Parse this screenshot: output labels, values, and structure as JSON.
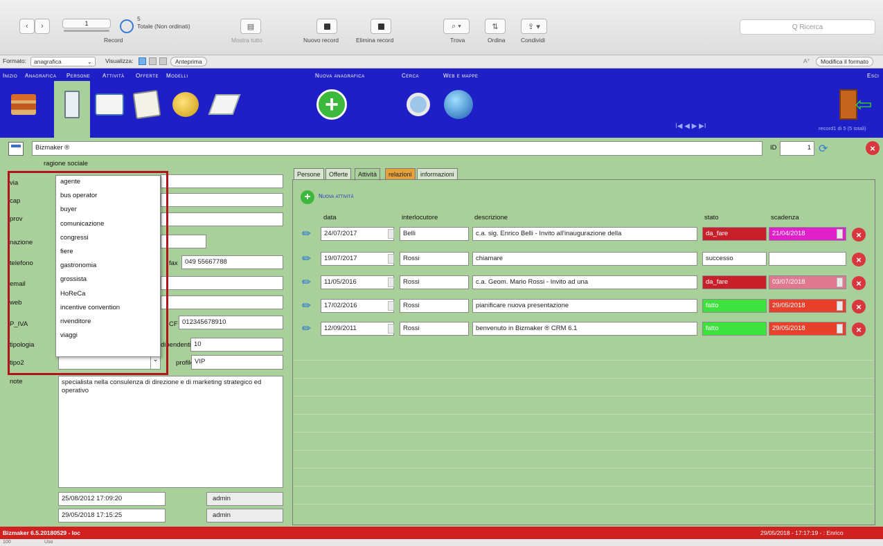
{
  "toolbar": {
    "record_value": "1",
    "record_label": "Record",
    "total_count": "5",
    "total_label": "Totale (Non ordinati)",
    "show_all_label": "Mostra tutto",
    "new_record_label": "Nuovo record",
    "delete_record_label": "Elimina record",
    "find_label": "Trova",
    "sort_label": "Ordina",
    "share_label": "Condividi",
    "search_placeholder": "Q Ricerca"
  },
  "format_row": {
    "format_label": "Formato:",
    "format_value": "anagrafica",
    "view_label": "Visualizza:",
    "preview_label": "Anteprima",
    "aa_label": "A°",
    "edit_format_label": "Modifica il formato"
  },
  "nav": {
    "items": [
      "Inizio",
      "Anagrafica",
      "Persone",
      "Attività",
      "Offerte",
      "Modelli"
    ],
    "new_anagrafica": "Nuova anagrafica",
    "search": "Cerca",
    "web_maps": "Web e mappe",
    "exit": "Esci",
    "pager": "I◀  ◀  ▶  ▶I",
    "record_counter": "record1 di 5 (5 totali)",
    "icons": [
      "books-icon",
      "folder-icon",
      "contact-card-icon",
      "checklist-icon",
      "coins-icon",
      "pencil-paper-icon",
      "plus-circle-icon",
      "magnifier-icon",
      "globe-icon",
      "exit-door-icon"
    ]
  },
  "record": {
    "name": "Bizmaker ®",
    "id_label": "ID",
    "id_value": "1",
    "section_label": "ragione sociale",
    "labels": [
      "via",
      "cap",
      "prov",
      "nazione",
      "telefono",
      "email",
      "web",
      "P_IVA",
      "tipologia",
      "tipo2",
      "note"
    ],
    "fax_label": "fax",
    "fax_value": "049 55667788",
    "cf_label": "CF",
    "cf_value": "012345678910",
    "dipendenti_label": "dipendenti",
    "dipendenti_value": "10",
    "profilo_label": "profilo",
    "profilo_value": "VIP",
    "note_value": "specialista nella consulenza di direzione e di marketing strategico ed operativo",
    "created_at": "25/08/2012 17:09:20",
    "created_by": "admin",
    "modified_at": "29/05/2018 17:15:25",
    "modified_by": "admin"
  },
  "dropdown": {
    "options": [
      "agente",
      "bus operator",
      "buyer",
      "comunicazione",
      "congressi",
      "fiere",
      "gastronomia",
      "grossista",
      "HoReCa",
      "incentive convention",
      "rivenditore",
      "viaggi"
    ]
  },
  "tabs": [
    "Persone",
    "Offerte",
    "Attività",
    "relazioni",
    "informazioni"
  ],
  "activities": {
    "new_label": "Nuova attività",
    "headers": [
      "data",
      "interlocutore",
      "descrizione",
      "stato",
      "scadenza"
    ],
    "rows": [
      {
        "date": "24/07/2017",
        "contact": "Belli",
        "description": "c.a. sig. Enrico Belli - Invito all'inaugurazione della",
        "status": "da_fare",
        "deadline": "21/04/2018",
        "status_color": "#c8202a",
        "deadline_color": "#e020c8"
      },
      {
        "date": "19/07/2017",
        "contact": "Rossi",
        "description": "chiamare",
        "status": "successo",
        "deadline": "",
        "status_color": "#ffffff",
        "deadline_color": "#ffffff"
      },
      {
        "date": "11/05/2016",
        "contact": "Rossi",
        "description": "c.a. Geom. Mario Rossi - Invito ad una",
        "status": "da_fare",
        "deadline": "03/07/2018",
        "status_color": "#c8202a",
        "deadline_color": "#e07890"
      },
      {
        "date": "17/02/2016",
        "contact": "Rossi",
        "description": "pianificare nuova presentazione",
        "status": "fatto",
        "deadline": "29/05/2018",
        "status_color": "#3ee23e",
        "deadline_color": "#e8402a"
      },
      {
        "date": "12/09/2011",
        "contact": "Rossi",
        "description": "benvenuto in Bizmaker ® CRM 6.1",
        "status": "fatto",
        "deadline": "29/05/2018",
        "status_color": "#3ee23e",
        "deadline_color": "#e8402a"
      }
    ]
  },
  "status_bar": {
    "left": "Bizmaker 6.5.20180529 - loc",
    "right": "29/05/2018 - 17:17:19 - : Enrico"
  },
  "bottom_bar": {
    "zoom": "100",
    "mode": "Uso"
  },
  "colors": {
    "nav_blue": "#1f1fc8",
    "content_green": "#a9cf9a",
    "status_red": "#d02020",
    "highlight_frame": "#b3121a"
  }
}
